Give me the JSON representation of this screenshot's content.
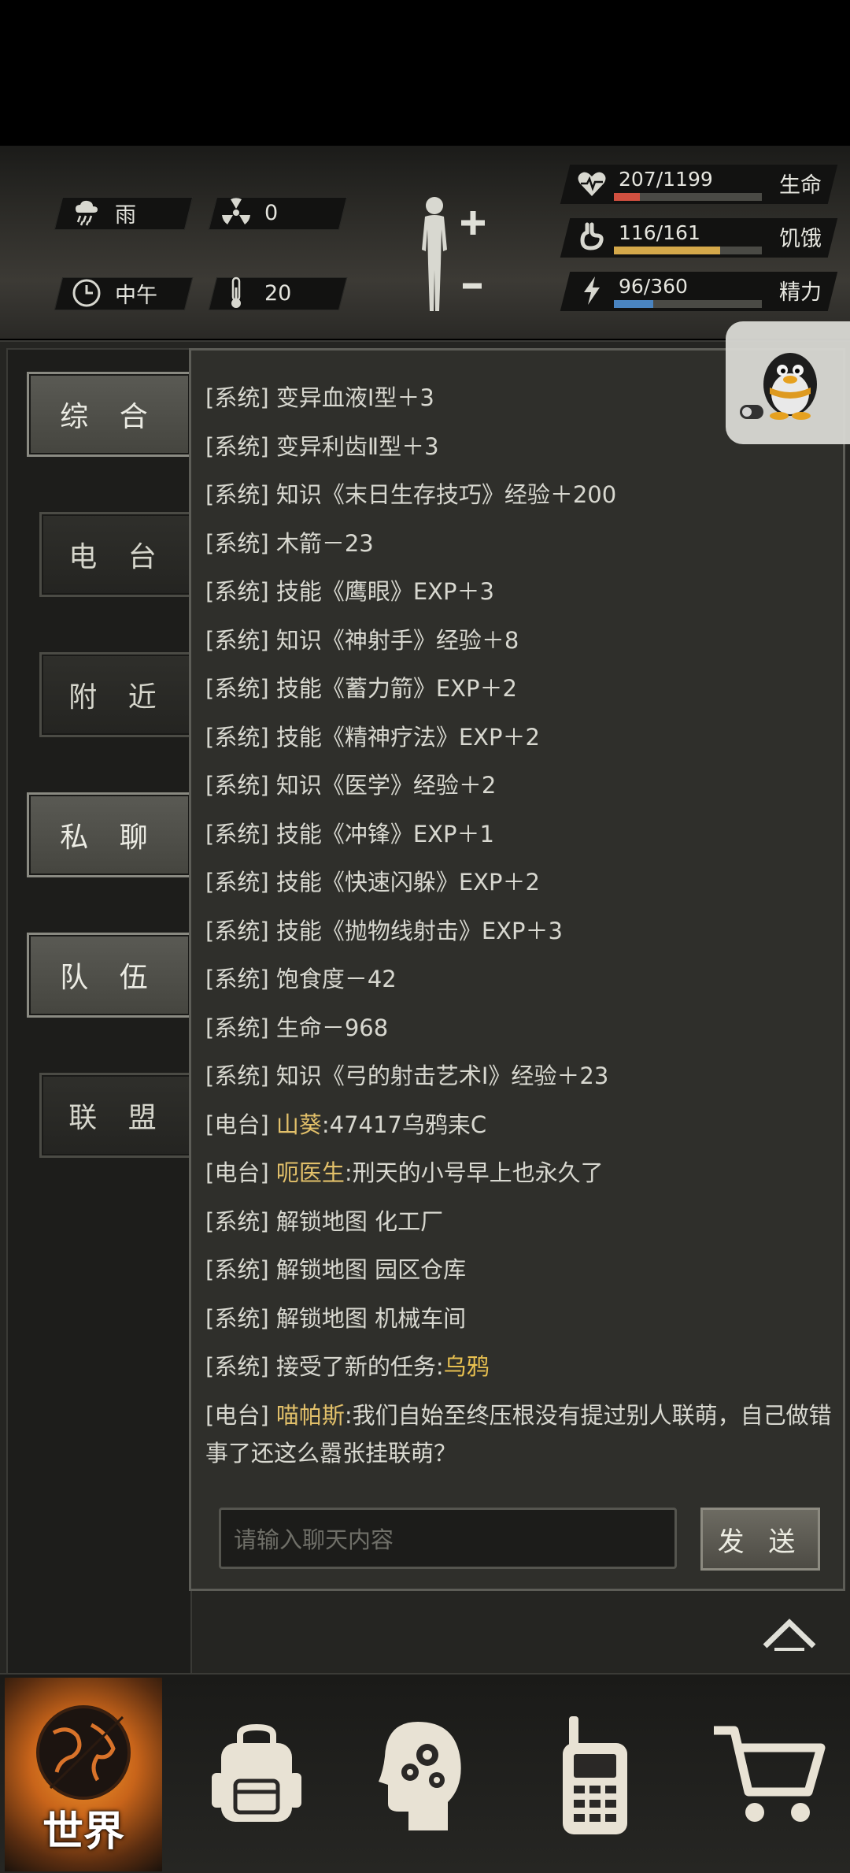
{
  "hud": {
    "weather": "雨",
    "radiation": "0",
    "time_of_day": "中午",
    "temperature": "20",
    "stats": [
      {
        "value": "207/1199",
        "label": "生命",
        "ratio": 0.173,
        "color": "#d05040",
        "icon": "heart-pulse-icon"
      },
      {
        "value": "116/161",
        "label": "饥饿",
        "ratio": 0.72,
        "color": "#d4a84a",
        "icon": "stomach-icon"
      },
      {
        "value": "96/360",
        "label": "精力",
        "ratio": 0.267,
        "color": "#4a84c0",
        "icon": "energy-icon"
      }
    ]
  },
  "tabs": [
    {
      "label": "综 合",
      "active": true
    },
    {
      "label": "电 台",
      "active": false
    },
    {
      "label": "附 近",
      "active": false
    },
    {
      "label": "私 聊",
      "active": true
    },
    {
      "label": "队 伍",
      "active": true
    },
    {
      "label": "联 盟",
      "active": false
    }
  ],
  "chat": {
    "messages": [
      {
        "channel": "[系统]",
        "text": "变异血液Ⅰ型＋3"
      },
      {
        "channel": "[系统]",
        "text": "变异利齿Ⅱ型＋3"
      },
      {
        "channel": "[系统]",
        "text": "知识《末日生存技巧》经验＋200"
      },
      {
        "channel": "[系统]",
        "text": "木箭－23"
      },
      {
        "channel": "[系统]",
        "text": "技能《鹰眼》EXP＋3"
      },
      {
        "channel": "[系统]",
        "text": "知识《神射手》经验＋8"
      },
      {
        "channel": "[系统]",
        "text": "技能《蓄力箭》EXP＋2"
      },
      {
        "channel": "[系统]",
        "text": "技能《精神疗法》EXP＋2"
      },
      {
        "channel": "[系统]",
        "text": "知识《医学》经验＋2"
      },
      {
        "channel": "[系统]",
        "text": "技能《冲锋》EXP＋1"
      },
      {
        "channel": "[系统]",
        "text": "技能《快速闪躲》EXP＋2"
      },
      {
        "channel": "[系统]",
        "text": "技能《抛物线射击》EXP＋3"
      },
      {
        "channel": "[系统]",
        "text": "饱食度－42"
      },
      {
        "channel": "[系统]",
        "text": "生命－968"
      },
      {
        "channel": "[系统]",
        "text": "知识《弓的射击艺术Ⅰ》经验＋23"
      }
    ],
    "radio1": {
      "channel": "[电台]",
      "name": "山葵",
      "text": ":47417乌鸦耒C"
    },
    "radio2": {
      "channel": "[电台]",
      "name": "呃医生",
      "text": ":刑天的小号早上也永久了"
    },
    "sys_after": [
      {
        "channel": "[系统]",
        "text": "解锁地图 化工厂"
      },
      {
        "channel": "[系统]",
        "text": "解锁地图 园区仓库"
      },
      {
        "channel": "[系统]",
        "text": "解锁地图 机械车间"
      }
    ],
    "task": {
      "channel": "[系统]",
      "text": "接受了新的任务:",
      "highlight": "乌鸦"
    },
    "radio3": {
      "channel": "[电台]",
      "name": "喵帕斯",
      "text": ":我们自始至终压根没有提过别人联萌，自己做错事了还这么嚣张挂联萌？"
    },
    "input_placeholder": "请输入聊天内容",
    "send_label": "发 送"
  },
  "nav": {
    "world_label": "世界",
    "items": [
      "backpack-icon",
      "skills-head-icon",
      "radio-phone-icon",
      "shop-cart-icon"
    ]
  }
}
